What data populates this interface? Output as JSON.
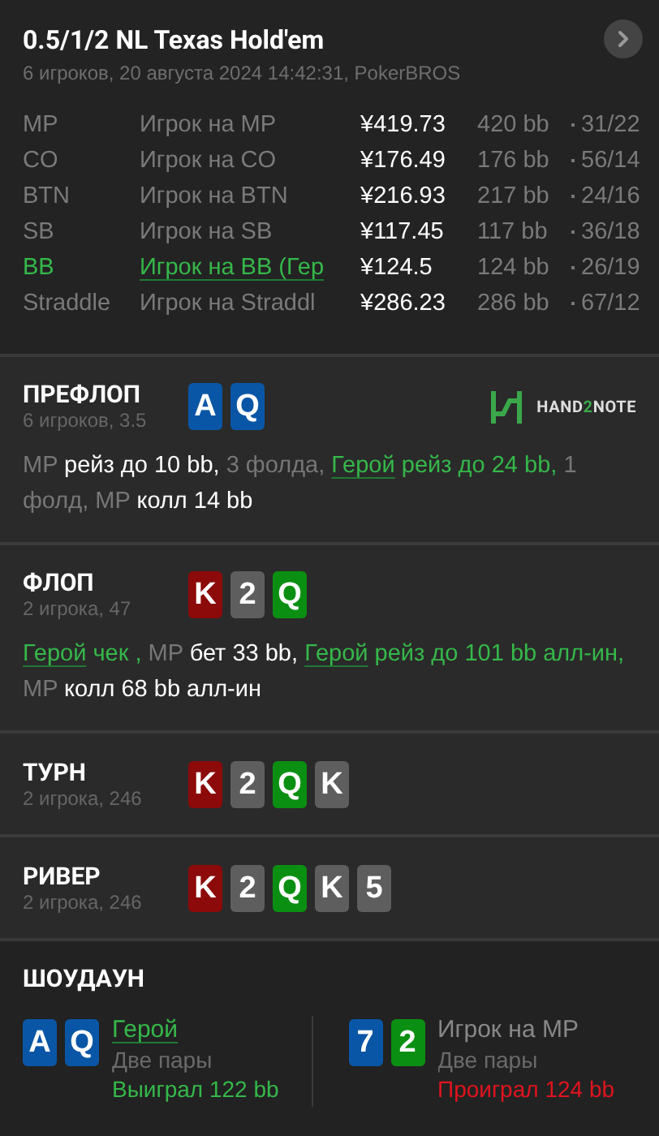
{
  "header": {
    "title": "0.5/1/2 NL Texas Hold'em",
    "subtitle": "6 игроков, 20 августа 2024 14:42:31, PokerBROS"
  },
  "players": [
    {
      "position": "MP",
      "name": "Игрок на MP",
      "stack": "¥419.73",
      "bb": "420 bb",
      "stat": "31/22",
      "hero": false
    },
    {
      "position": "CO",
      "name": "Игрок на CO",
      "stack": "¥176.49",
      "bb": "176 bb",
      "stat": "56/14",
      "hero": false
    },
    {
      "position": "BTN",
      "name": "Игрок на BTN",
      "stack": "¥216.93",
      "bb": "217 bb",
      "stat": "24/16",
      "hero": false
    },
    {
      "position": "SB",
      "name": "Игрок на SB",
      "stack": "¥117.45",
      "bb": "117 bb",
      "stat": "36/18",
      "hero": false
    },
    {
      "position": "BB",
      "name": "Игрок на BB (Гер",
      "stack": "¥124.5",
      "bb": "124 bb",
      "stat": "26/19",
      "hero": true
    },
    {
      "position": "Straddle",
      "name": "Игрок на Straddl",
      "stack": "¥286.23",
      "bb": "286 bb",
      "stat": "67/12",
      "hero": false
    }
  ],
  "logo": {
    "before": "HAND",
    "accent": "2",
    "after": "NOTE"
  },
  "streets": [
    {
      "title": "ПРЕФЛОП",
      "info": "6 игроков, 3.5",
      "cards": [
        {
          "rank": "A",
          "color": "#0a56a6"
        },
        {
          "rank": "Q",
          "color": "#0a56a6"
        }
      ],
      "actions": [
        {
          "text": "MP",
          "kind": "muted"
        },
        {
          "text": "рейз до 10 bb,",
          "kind": "action"
        },
        {
          "text": "3 фолда,",
          "kind": "muted"
        },
        {
          "text": "Герой",
          "kind": "hero"
        },
        {
          "text": "рейз до 24 bb,",
          "kind": "hero-action"
        },
        {
          "text": "1 фолд, MP",
          "kind": "muted"
        },
        {
          "text": "колл 14 bb",
          "kind": "action"
        }
      ]
    },
    {
      "title": "ФЛОП",
      "info": "2 игрока, 47",
      "cards": [
        {
          "rank": "K",
          "color": "#8c0a0a"
        },
        {
          "rank": "2",
          "color": "#5e5e5e"
        },
        {
          "rank": "Q",
          "color": "#0b8f12"
        }
      ],
      "actions": [
        {
          "text": "Герой",
          "kind": "hero"
        },
        {
          "text": "чек ,",
          "kind": "hero-action"
        },
        {
          "text": "MP",
          "kind": "muted"
        },
        {
          "text": "бет 33 bb,",
          "kind": "action"
        },
        {
          "text": "Герой",
          "kind": "hero"
        },
        {
          "text": "рейз до 101 bb алл-ин,",
          "kind": "hero-action"
        },
        {
          "text": "MP",
          "kind": "muted"
        },
        {
          "text": "колл 68 bb алл-ин",
          "kind": "action"
        }
      ]
    },
    {
      "title": "ТУРН",
      "info": "2 игрока, 246",
      "cards": [
        {
          "rank": "K",
          "color": "#8c0a0a"
        },
        {
          "rank": "2",
          "color": "#5e5e5e"
        },
        {
          "rank": "Q",
          "color": "#0b8f12"
        },
        {
          "rank": "K",
          "color": "#5e5e5e"
        }
      ]
    },
    {
      "title": "РИВЕР",
      "info": "2 игрока, 246",
      "cards": [
        {
          "rank": "K",
          "color": "#8c0a0a"
        },
        {
          "rank": "2",
          "color": "#5e5e5e"
        },
        {
          "rank": "Q",
          "color": "#0b8f12"
        },
        {
          "rank": "K",
          "color": "#5e5e5e"
        },
        {
          "rank": "5",
          "color": "#5e5e5e"
        }
      ]
    }
  ],
  "showdown": {
    "title": "ШОУДАУН",
    "players": [
      {
        "name": "Герой",
        "hero": true,
        "hand": "Две пары",
        "result": "Выиграл 122 bb",
        "won": true,
        "cards": [
          {
            "rank": "A",
            "color": "#0a56a6"
          },
          {
            "rank": "Q",
            "color": "#0a56a6"
          }
        ]
      },
      {
        "name": "Игрок на MP",
        "hero": false,
        "hand": "Две пары",
        "result": "Проиграл 124 bb",
        "won": false,
        "cards": [
          {
            "rank": "7",
            "color": "#0a56a6"
          },
          {
            "rank": "2",
            "color": "#0b8f12"
          }
        ]
      }
    ]
  }
}
